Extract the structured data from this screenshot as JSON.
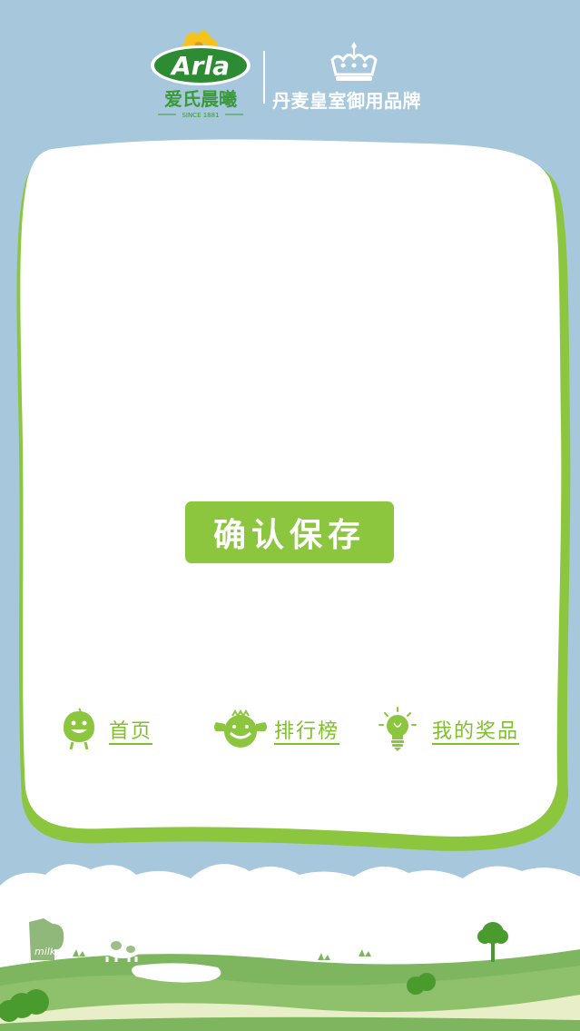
{
  "header": {
    "brand_logo_text": "Arla",
    "brand_chinese": "爱氏晨曦",
    "brand_since": "SINCE 1881",
    "royal_text": "丹麦皇室御用品牌"
  },
  "main": {
    "confirm_label": "确认保存"
  },
  "nav": {
    "home_label": "首页",
    "rank_label": "排行榜",
    "prize_label": "我的奖品"
  },
  "landscape": {
    "milk_label": "milk"
  },
  "colors": {
    "sky": "#a6c7dc",
    "accent_green": "#8cc63e",
    "nav_green": "#7fbf2b",
    "hill_green": "#7db65f"
  }
}
